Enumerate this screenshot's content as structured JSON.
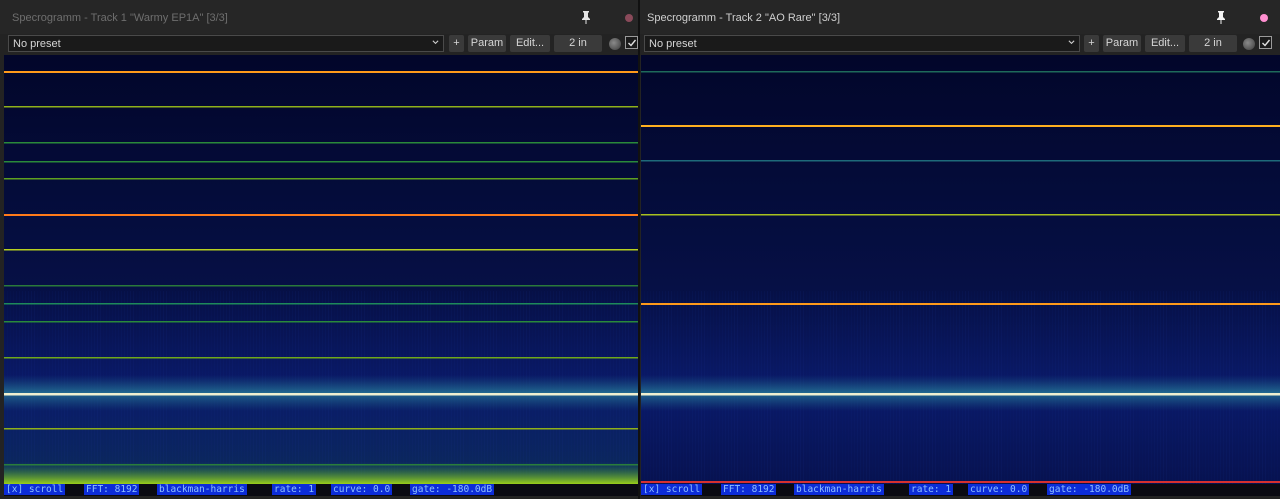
{
  "panels": [
    {
      "title": "Specrogramm - Track 1 \"Warmy EP1A\" [3/3]",
      "preset": "No preset",
      "buttons": {
        "add": "+",
        "param": "Param",
        "edit": "Edit...",
        "io": "2 in"
      },
      "status": {
        "scroll": "[x] scroll",
        "fft": "FFT: 8192",
        "window": "blackman-harris",
        "rate": "rate: 1",
        "curve": "curve: 0.0",
        "gate": "gate: -180.0dB"
      },
      "accent_dot": "#8a4a5a"
    },
    {
      "title": "Specrogramm - Track 2 \"AO Rare\" [3/3]",
      "preset": "No preset",
      "buttons": {
        "add": "+",
        "param": "Param",
        "edit": "Edit...",
        "io": "2 in"
      },
      "status": {
        "scroll": "[x] scroll",
        "fft": "FFT: 8192",
        "window": "blackman-harris",
        "rate": "rate: 1",
        "curve": "curve: 0.0",
        "gate": "gate: -180.0dB"
      },
      "accent_dot": "#ff8fd0"
    }
  ],
  "colors": {
    "status_bg": "#0c2cd8",
    "status_fg": "#8ec0ff",
    "spectrogram_bg": "#050a3a"
  }
}
